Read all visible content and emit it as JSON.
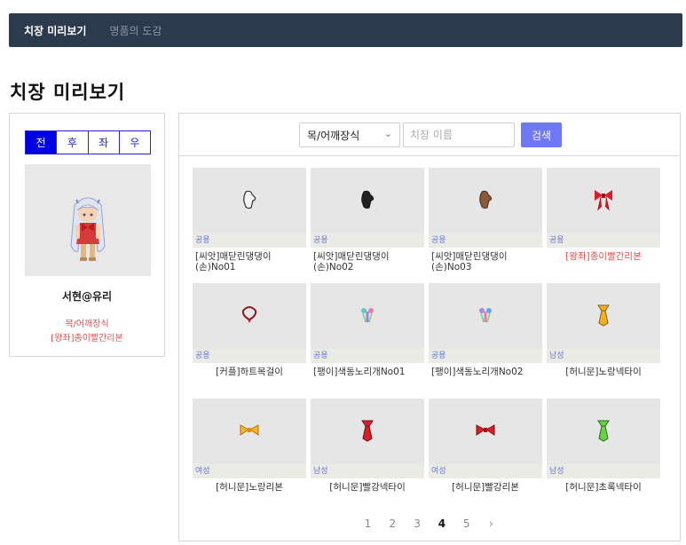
{
  "nav": {
    "items": [
      {
        "label": "치장 미리보기",
        "active": true
      },
      {
        "label": "명품의 도감",
        "active": false
      }
    ]
  },
  "page": {
    "title": "치장 미리보기"
  },
  "left": {
    "directions": [
      "전",
      "후",
      "좌",
      "우"
    ],
    "active_direction": "전",
    "character_name": "서현@유리",
    "category": "목/어깨장식",
    "item": "[왕좌]종이빨간리본"
  },
  "search": {
    "category_selected": "목/어깨장식",
    "placeholder": "치장 이름",
    "button_label": "검색"
  },
  "items": [
    {
      "gender": "공용",
      "name": "[씨앗]매닫린댕댕이(손)No01",
      "align": "left",
      "highlight": false,
      "icon": "mitten-white-icon"
    },
    {
      "gender": "공용",
      "name": "[씨앗]매닫린댕댕이(손)No02",
      "align": "left",
      "highlight": false,
      "icon": "mitten-black-icon"
    },
    {
      "gender": "공용",
      "name": "[씨앗]매닫린댕댕이(손)No03",
      "align": "left",
      "highlight": false,
      "icon": "mitten-brown-icon"
    },
    {
      "gender": "공용",
      "name": "[왕좌]종이빨간리본",
      "align": "center",
      "highlight": true,
      "icon": "red-ribbon-icon"
    },
    {
      "gender": "공용",
      "name": "[커플]하트목걸이",
      "align": "center",
      "highlight": false,
      "icon": "heart-necklace-icon"
    },
    {
      "gender": "공용",
      "name": "[팽이]색동노리개No01",
      "align": "left",
      "highlight": false,
      "icon": "norigae-icon"
    },
    {
      "gender": "공용",
      "name": "[팽이]색동노리개No02",
      "align": "left",
      "highlight": false,
      "icon": "norigae-icon"
    },
    {
      "gender": "남성",
      "name": "[허니문]노랑넥타이",
      "align": "center",
      "highlight": false,
      "icon": "yellow-necktie-icon"
    },
    {
      "gender": "여성",
      "name": "[허니문]노랑리본",
      "align": "center",
      "highlight": false,
      "icon": "yellow-ribbon-icon"
    },
    {
      "gender": "남성",
      "name": "[허니문]빨강넥타이",
      "align": "center",
      "highlight": false,
      "icon": "red-necktie-icon"
    },
    {
      "gender": "여성",
      "name": "[허니문]빨강리본",
      "align": "center",
      "highlight": false,
      "icon": "red-bow-icon"
    },
    {
      "gender": "남성",
      "name": "[허니문]초록넥타이",
      "align": "center",
      "highlight": false,
      "icon": "green-necktie-icon"
    }
  ],
  "pagination": {
    "pages": [
      "1",
      "2",
      "3",
      "4",
      "5"
    ],
    "current": "4",
    "next_symbol": "›"
  }
}
